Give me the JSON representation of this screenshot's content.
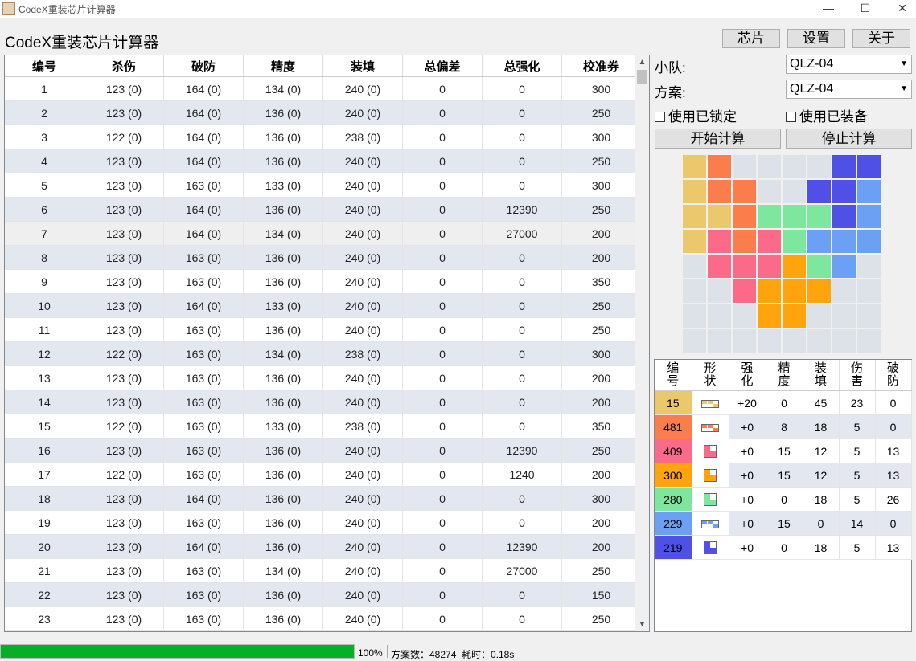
{
  "window": {
    "title": "CodeX重装芯片计算器",
    "minimize": "—",
    "maximize": "☐",
    "close": "✕"
  },
  "heading": "CodeX重装芯片计算器",
  "top_buttons": {
    "chips": "芯片",
    "settings": "设置",
    "about": "关于"
  },
  "grid": {
    "columns": [
      "编号",
      "杀伤",
      "破防",
      "精度",
      "装填",
      "总偏差",
      "总强化",
      "校准券"
    ],
    "rows": [
      [
        "1",
        "123 (0)",
        "164 (0)",
        "134 (0)",
        "240 (0)",
        "0",
        "0",
        "300"
      ],
      [
        "2",
        "123 (0)",
        "164 (0)",
        "136 (0)",
        "240 (0)",
        "0",
        "0",
        "250"
      ],
      [
        "3",
        "122 (0)",
        "164 (0)",
        "136 (0)",
        "238 (0)",
        "0",
        "0",
        "300"
      ],
      [
        "4",
        "123 (0)",
        "164 (0)",
        "136 (0)",
        "240 (0)",
        "0",
        "0",
        "250"
      ],
      [
        "5",
        "123 (0)",
        "163 (0)",
        "133 (0)",
        "240 (0)",
        "0",
        "0",
        "300"
      ],
      [
        "6",
        "123 (0)",
        "164 (0)",
        "136 (0)",
        "240 (0)",
        "0",
        "12390",
        "250"
      ],
      [
        "7",
        "123 (0)",
        "164 (0)",
        "134 (0)",
        "240 (0)",
        "0",
        "27000",
        "200"
      ],
      [
        "8",
        "123 (0)",
        "163 (0)",
        "136 (0)",
        "240 (0)",
        "0",
        "0",
        "200"
      ],
      [
        "9",
        "123 (0)",
        "163 (0)",
        "136 (0)",
        "240 (0)",
        "0",
        "0",
        "350"
      ],
      [
        "10",
        "123 (0)",
        "164 (0)",
        "133 (0)",
        "240 (0)",
        "0",
        "0",
        "250"
      ],
      [
        "11",
        "123 (0)",
        "163 (0)",
        "136 (0)",
        "240 (0)",
        "0",
        "0",
        "250"
      ],
      [
        "12",
        "122 (0)",
        "163 (0)",
        "134 (0)",
        "238 (0)",
        "0",
        "0",
        "300"
      ],
      [
        "13",
        "123 (0)",
        "163 (0)",
        "136 (0)",
        "240 (0)",
        "0",
        "0",
        "200"
      ],
      [
        "14",
        "123 (0)",
        "163 (0)",
        "136 (0)",
        "240 (0)",
        "0",
        "0",
        "200"
      ],
      [
        "15",
        "122 (0)",
        "163 (0)",
        "133 (0)",
        "238 (0)",
        "0",
        "0",
        "350"
      ],
      [
        "16",
        "123 (0)",
        "163 (0)",
        "136 (0)",
        "240 (0)",
        "0",
        "12390",
        "250"
      ],
      [
        "17",
        "122 (0)",
        "163 (0)",
        "136 (0)",
        "240 (0)",
        "0",
        "1240",
        "200"
      ],
      [
        "18",
        "123 (0)",
        "164 (0)",
        "136 (0)",
        "240 (0)",
        "0",
        "0",
        "300"
      ],
      [
        "19",
        "123 (0)",
        "163 (0)",
        "136 (0)",
        "240 (0)",
        "0",
        "0",
        "200"
      ],
      [
        "20",
        "123 (0)",
        "164 (0)",
        "136 (0)",
        "240 (0)",
        "0",
        "12390",
        "200"
      ],
      [
        "21",
        "123 (0)",
        "163 (0)",
        "134 (0)",
        "240 (0)",
        "0",
        "27000",
        "250"
      ],
      [
        "22",
        "123 (0)",
        "163 (0)",
        "136 (0)",
        "240 (0)",
        "0",
        "0",
        "150"
      ],
      [
        "23",
        "123 (0)",
        "163 (0)",
        "136 (0)",
        "240 (0)",
        "0",
        "0",
        "250"
      ]
    ],
    "selected_row": 7
  },
  "controls": {
    "team_label": "小队:",
    "team_value": "QLZ-04",
    "plan_label": "方案:",
    "plan_value": "QLZ-04",
    "use_locked": "使用已锁定",
    "use_equipped": "使用已装备",
    "start": "开始计算",
    "stop": "停止计算"
  },
  "board": {
    "empty_color": "#dde1e8",
    "cells": [
      [
        "#ebc86c",
        "#fb7d4c",
        "",
        "",
        "",
        "",
        "#4f50e5",
        "#4f50e5"
      ],
      [
        "#ebc86c",
        "#fb7d4c",
        "#fb7d4c",
        "",
        "",
        "#4f50e5",
        "#4f50e5",
        "#6ba0f5"
      ],
      [
        "#ebc86c",
        "#ebc86c",
        "#fb7d4c",
        "#7ee79e",
        "#7ee79e",
        "#7ee79e",
        "#4f50e5",
        "#6ba0f5"
      ],
      [
        "#ebc86c",
        "#fb6a88",
        "#fb7d4c",
        "#fb6a88",
        "#7ee79e",
        "#6ba0f5",
        "#6ba0f5",
        "#6ba0f5"
      ],
      [
        "",
        "#fb6a88",
        "#fb6a88",
        "#fb6a88",
        "#ffa40c",
        "#7ee79e",
        "#6ba0f5",
        ""
      ],
      [
        "",
        "",
        "#fb6a88",
        "#ffa40c",
        "#ffa40c",
        "#ffa40c",
        "",
        ""
      ],
      [
        "",
        "",
        "",
        "#ffa40c",
        "#ffa40c",
        "",
        "",
        ""
      ],
      [
        "",
        "",
        "",
        "",
        "",
        "",
        "",
        ""
      ]
    ]
  },
  "parts": {
    "headers": [
      "编\n号",
      "形\n状",
      "强\n化",
      "精\n度",
      "装\n填",
      "伤\n害",
      "破\n防"
    ],
    "rows": [
      {
        "id": "15",
        "color": "#ebc86c",
        "shape": "bar",
        "boost": "+20",
        "precision": "0",
        "reload": "45",
        "damage": "23",
        "breach": "0"
      },
      {
        "id": "481",
        "color": "#fb7d4c",
        "shape": "bar",
        "boost": "+0",
        "precision": "8",
        "reload": "18",
        "damage": "5",
        "breach": "0"
      },
      {
        "id": "409",
        "color": "#fb6a88",
        "shape": "square",
        "boost": "+0",
        "precision": "15",
        "reload": "12",
        "damage": "5",
        "breach": "13"
      },
      {
        "id": "300",
        "color": "#ffa40c",
        "shape": "square",
        "boost": "+0",
        "precision": "15",
        "reload": "12",
        "damage": "5",
        "breach": "13"
      },
      {
        "id": "280",
        "color": "#7ee79e",
        "shape": "square",
        "boost": "+0",
        "precision": "0",
        "reload": "18",
        "damage": "5",
        "breach": "26"
      },
      {
        "id": "229",
        "color": "#6ba0f5",
        "shape": "bar",
        "boost": "+0",
        "precision": "15",
        "reload": "0",
        "damage": "14",
        "breach": "0"
      },
      {
        "id": "219",
        "color": "#4f50e5",
        "shape": "square",
        "boost": "+0",
        "precision": "0",
        "reload": "18",
        "damage": "5",
        "breach": "13"
      }
    ]
  },
  "status": {
    "progress": 1.0,
    "progress_text": "100%",
    "plans_text": "方案数：48274",
    "time_text": "耗时：0.18s"
  }
}
